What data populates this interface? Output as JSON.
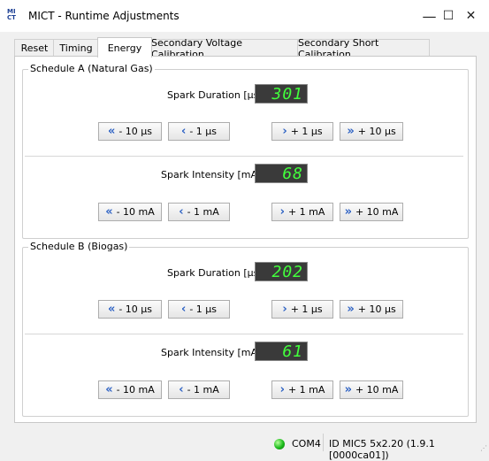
{
  "window": {
    "title": "MICT - Runtime Adjustments",
    "icon_text": "MI CT",
    "controls": {
      "minimize": "—",
      "maximize": "☐",
      "close": "✕"
    }
  },
  "tabs": [
    {
      "label": "Reset",
      "active": false
    },
    {
      "label": "Timing",
      "active": false
    },
    {
      "label": "Energy",
      "active": true
    },
    {
      "label": "Secondary Voltage Calibration",
      "active": false
    },
    {
      "label": "Secondary Short Calibration",
      "active": false
    }
  ],
  "schedules": [
    {
      "title": "Schedule A (Natural Gas)",
      "duration": {
        "label": "Spark Duration [µs]",
        "value": "301",
        "buttons": [
          "- 10 µs",
          "- 1 µs",
          "+ 1 µs",
          "+ 10 µs"
        ]
      },
      "intensity": {
        "label": "Spark Intensity [mA]",
        "value": "68",
        "buttons": [
          "- 10 mA",
          "- 1 mA",
          "+ 1 mA",
          "+ 10 mA"
        ]
      }
    },
    {
      "title": "Schedule B (Biogas)",
      "duration": {
        "label": "Spark Duration [µs]",
        "value": "202",
        "buttons": [
          "- 10 µs",
          "- 1 µs",
          "+ 1 µs",
          "+ 10 µs"
        ]
      },
      "intensity": {
        "label": "Spark Intensity [mA]",
        "value": "61",
        "buttons": [
          "- 10 mA",
          "- 1 mA",
          "+ 1 mA",
          "+ 10 mA"
        ]
      }
    }
  ],
  "status": {
    "port": "COM4",
    "device_id": "ID MIC5 5x2.20 (1.9.1 [0000ca01])",
    "led_color": "#1bbb1b"
  },
  "colors": {
    "lcd_text": "#42ff3c",
    "arrow": "#2f63c4"
  }
}
